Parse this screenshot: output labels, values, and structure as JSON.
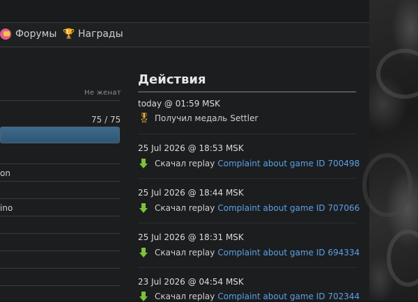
{
  "nav": {
    "items": [
      {
        "label": "Форумы",
        "icon": "forum-icon"
      },
      {
        "label": "Награды",
        "icon": "trophy-icon"
      }
    ]
  },
  "profile": {
    "status": "Не женат",
    "progress_text": "75 / 75",
    "progress_fraction": 1.0,
    "fragments": [
      "on",
      "ino"
    ]
  },
  "actions": {
    "title": "Действия",
    "entries": [
      {
        "time": "today @ 01:59 MSK",
        "icon": "medal-icon",
        "text": "Получил медаль",
        "link": "Settler",
        "link_color": "#cfcfcf"
      },
      {
        "time": "25 Jul 2026 @ 18:53 MSK",
        "icon": "download-icon",
        "text": "Скачал replay",
        "link": "Complaint about game ID 700498"
      },
      {
        "time": "25 Jul 2026 @ 18:44 MSK",
        "icon": "download-icon",
        "text": "Скачал replay",
        "link": "Complaint about game ID 707066"
      },
      {
        "time": "25 Jul 2026 @ 18:31 MSK",
        "icon": "download-icon",
        "text": "Скачал replay",
        "link": "Complaint about game ID 694334"
      },
      {
        "time": "23 Jul 2026 @ 04:54 MSK",
        "icon": "download-icon",
        "text": "Скачал replay",
        "link": "Complaint about game ID 702344"
      }
    ]
  },
  "colors": {
    "link": "#5aa1e6",
    "accent_bar": "#3d6a8c",
    "background": "#1c1d1f"
  }
}
